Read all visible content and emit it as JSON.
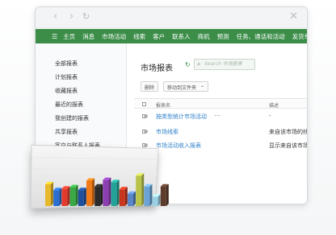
{
  "window_controls": {
    "back_icon": "chevron-left-icon",
    "forward_icon": "chevron-right-icon",
    "refresh_icon": "refresh-icon",
    "close_icon": "close-icon"
  },
  "navbar": {
    "color": "#3b8d48",
    "items": [
      "主页",
      "消息",
      "市场活动",
      "线索",
      "客户",
      "联系人",
      "商机",
      "预测",
      "任务、通话和活动",
      "发货单"
    ]
  },
  "sidebar": {
    "items": [
      "全部报表",
      "计划报表",
      "收藏报表",
      "最近的报表",
      "我创建的报表",
      "共享报表",
      "客户与联系人报表"
    ]
  },
  "main": {
    "title": "市场报表",
    "search_placeholder": "Search 市场报表",
    "toolbar": {
      "delete_label": "删除",
      "move_label": "移动到文件夹"
    },
    "table": {
      "headers": [
        "报表名",
        "描述"
      ],
      "rows": [
        {
          "name": "按类型统计市场活动",
          "desc": "-"
        },
        {
          "name": "市场线索",
          "desc": "来自该市场的线索"
        },
        {
          "name": "市场活动收入报表",
          "desc": "显示来自该市场的收入"
        }
      ]
    }
  },
  "chart_data": {
    "type": "bar",
    "bars": [
      {
        "value": 3.0,
        "color": "#e8b82c"
      },
      {
        "value": 2.2,
        "color": "#2a6fd1"
      },
      {
        "value": 2.4,
        "color": "#e23b2e"
      },
      {
        "value": 2.6,
        "color": "#39a845"
      },
      {
        "value": 2.2,
        "color": "#1d4f9c"
      },
      {
        "value": 3.5,
        "color": "#ef7a19"
      },
      {
        "value": 2.7,
        "color": "#2a2a2a"
      },
      {
        "value": 3.6,
        "color": "#8b3fb0"
      },
      {
        "value": 3.3,
        "color": "#23a398"
      },
      {
        "value": 2.3,
        "color": "#c7351c"
      },
      {
        "value": 1.7,
        "color": "#5a86c7"
      },
      {
        "value": 4.2,
        "color": "#b9c34a"
      },
      {
        "value": 2.7,
        "color": "#6aa4d6"
      },
      {
        "value": 1.3,
        "color": "#9ad0e3"
      },
      {
        "value": 2.7,
        "color": "#5d3b2d"
      }
    ]
  }
}
